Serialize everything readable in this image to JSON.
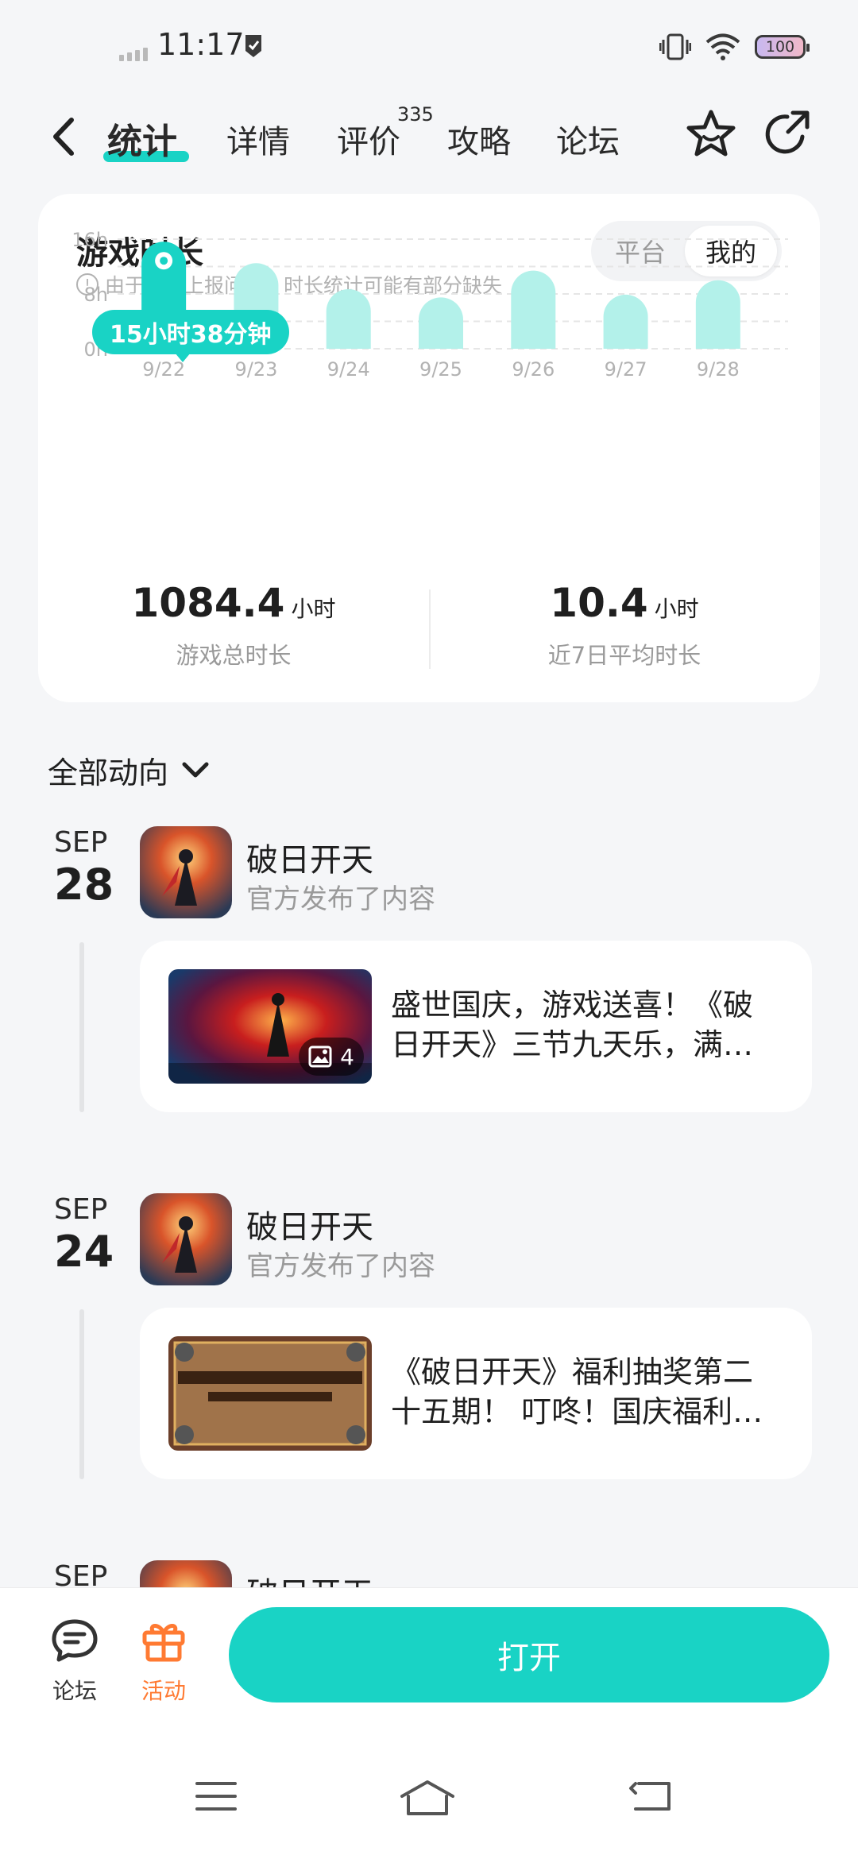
{
  "status_bar": {
    "time": "11:17",
    "battery": "100"
  },
  "nav": {
    "tabs": [
      "统计",
      "详情",
      "评价",
      "攻略",
      "论坛"
    ],
    "review_count": "335"
  },
  "stats": {
    "title": "游戏时长",
    "note": "由于系统上报问题，时长统计可能有部分缺失",
    "segment": {
      "platform": "平台",
      "mine": "我的"
    },
    "tooltip": "15小时38分钟",
    "total": {
      "value": "1084.4",
      "unit": "小时",
      "label": "游戏总时长"
    },
    "average": {
      "value": "10.4",
      "unit": "小时",
      "label": "近7日平均时长"
    }
  },
  "chart_data": {
    "type": "bar",
    "categories": [
      "9/22",
      "9/23",
      "9/24",
      "9/25",
      "9/26",
      "9/27",
      "9/28"
    ],
    "values": [
      15.63,
      12.5,
      8.7,
      7.5,
      11.4,
      7.9,
      10.0
    ],
    "ytick_labels": [
      "16h",
      "8h",
      "0h"
    ],
    "ylim": [
      0,
      16
    ],
    "grid": true,
    "highlight_index": 0,
    "colors": {
      "highlight": "#19d3c5",
      "normal": "#b3f1ea"
    }
  },
  "feed": {
    "filter": "全部动向",
    "items": [
      {
        "month": "SEP",
        "day": "28",
        "app": "破日开天",
        "subtitle": "官方发布了内容",
        "post": "盛世国庆，游戏送喜！《破日开天》三节九天乐，满满福利来袭！",
        "image_count": "4"
      },
      {
        "month": "SEP",
        "day": "24",
        "app": "破日开天",
        "subtitle": "官方发布了内容",
        "post": "《破日开天》福利抽奖第二十五期！ 叮咚！国庆福利来啦！"
      },
      {
        "month": "SEP",
        "day": "",
        "app": "破日开天",
        "subtitle": ""
      }
    ]
  },
  "bottom": {
    "forum": "论坛",
    "activity": "活动",
    "open": "打开"
  }
}
